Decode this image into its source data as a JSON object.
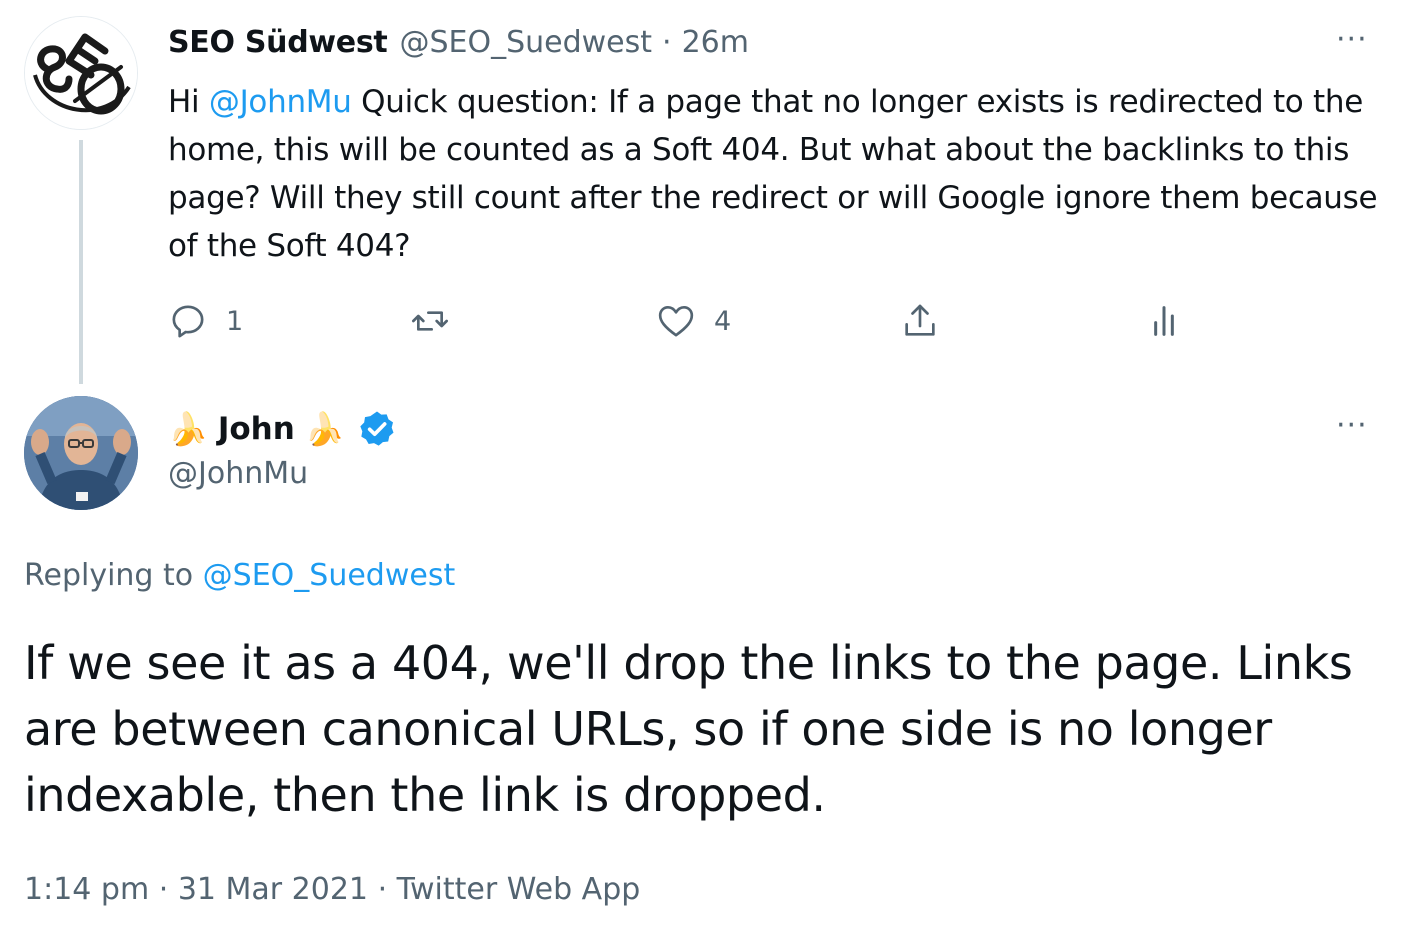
{
  "parent_tweet": {
    "author_name": "SEO Südwest",
    "author_handle": "@SEO_Suedwest",
    "separator": "·",
    "time_ago": "26m",
    "more_label": "···",
    "text_prefix": "Hi ",
    "text_mention": "@JohnMu",
    "text_body": " Quick question: If a page that no longer exists is redirected to the home, this will be counted as a Soft 404. But what about the backlinks to this page? Will they still count after the redirect or will Google ignore them because of the Soft 404?",
    "actions": {
      "reply_count": "1",
      "like_count": "4"
    },
    "avatar_icon": "seo-logo"
  },
  "reply_tweet": {
    "name_emoji_left": "🍌",
    "author_name": "John",
    "name_emoji_right": "🍌",
    "verified_icon": "verified-badge-icon",
    "author_handle": "@JohnMu",
    "more_label": "···",
    "replying_prefix": "Replying to ",
    "replying_to": "@SEO_Suedwest",
    "text": "If we see it as a 404, we'll drop the links to the page. Links are between canonical URLs, so if one side is no longer indexable, then the link is dropped.",
    "time": "1:14 pm",
    "separator": "·",
    "date": "31 Mar 2021",
    "source": "Twitter Web App"
  },
  "colors": {
    "text_primary": "#0f1419",
    "text_secondary": "#536471",
    "accent": "#1d9bf0",
    "thread_line": "#cfd9de"
  }
}
